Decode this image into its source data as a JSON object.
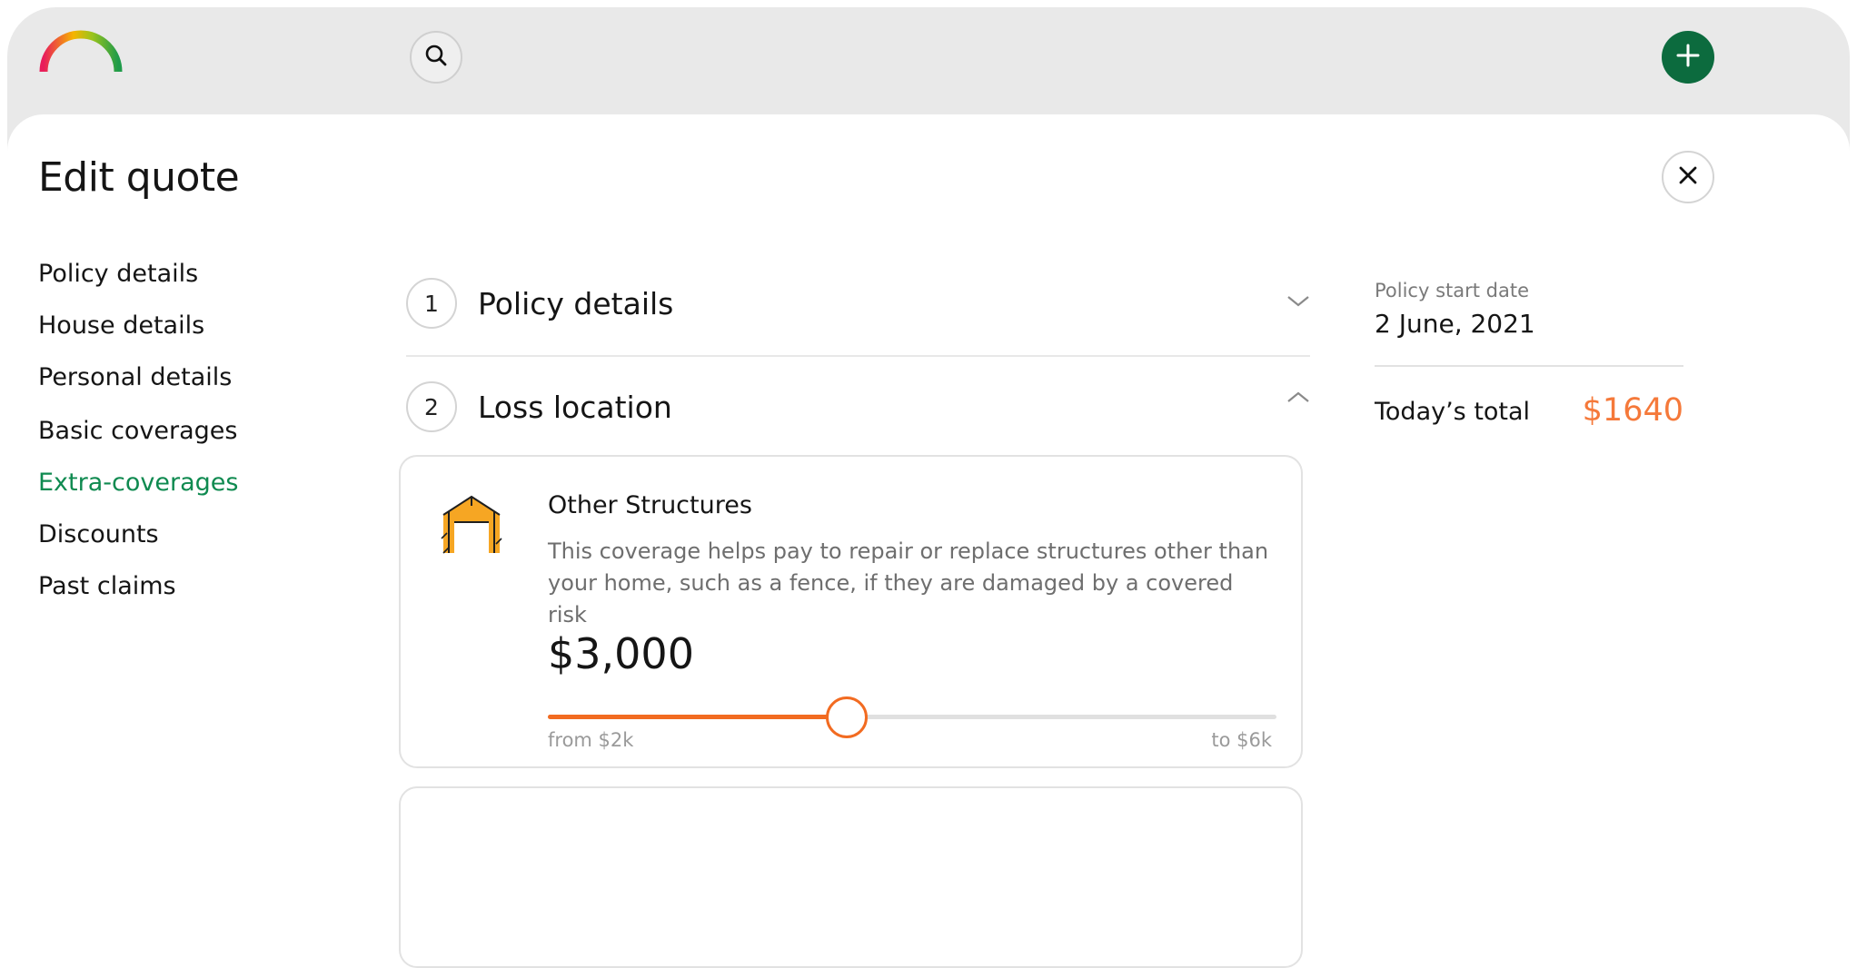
{
  "header": {
    "logo_icon": "gauge-arc-logo",
    "search_icon": "search-icon",
    "add_icon": "plus-icon"
  },
  "panel": {
    "title": "Edit quote",
    "close_icon": "close-icon"
  },
  "sidebar": {
    "items": [
      {
        "label": "Policy details",
        "active": false
      },
      {
        "label": "House details",
        "active": false
      },
      {
        "label": "Personal details",
        "active": false
      },
      {
        "label": "Basic coverages",
        "active": false
      },
      {
        "label": "Extra-coverages",
        "active": true
      },
      {
        "label": "Discounts",
        "active": false
      },
      {
        "label": "Past claims",
        "active": false
      }
    ]
  },
  "steps": [
    {
      "number": "1",
      "title": "Policy details",
      "expanded": false
    },
    {
      "number": "2",
      "title": "Loss location",
      "expanded": true
    }
  ],
  "coverage_card": {
    "icon": "structure-icon",
    "title": "Other Structures",
    "description": "This coverage helps pay to repair or replace structures other than your home, such as a fence, if they are damaged by a covered risk",
    "amount": "$3,000",
    "slider": {
      "min_label": "from $2k",
      "max_label": "to $6k",
      "fraction": 0.41
    }
  },
  "summary": {
    "start_date_label": "Policy start date",
    "start_date": "2 June, 2021",
    "total_label": "Today’s total",
    "total_value": "$1640"
  },
  "colors": {
    "brand_green": "#0c6b3e",
    "active_nav": "#0f8a50",
    "accent_orange": "#f26b21",
    "total_orange": "#f5793a"
  }
}
